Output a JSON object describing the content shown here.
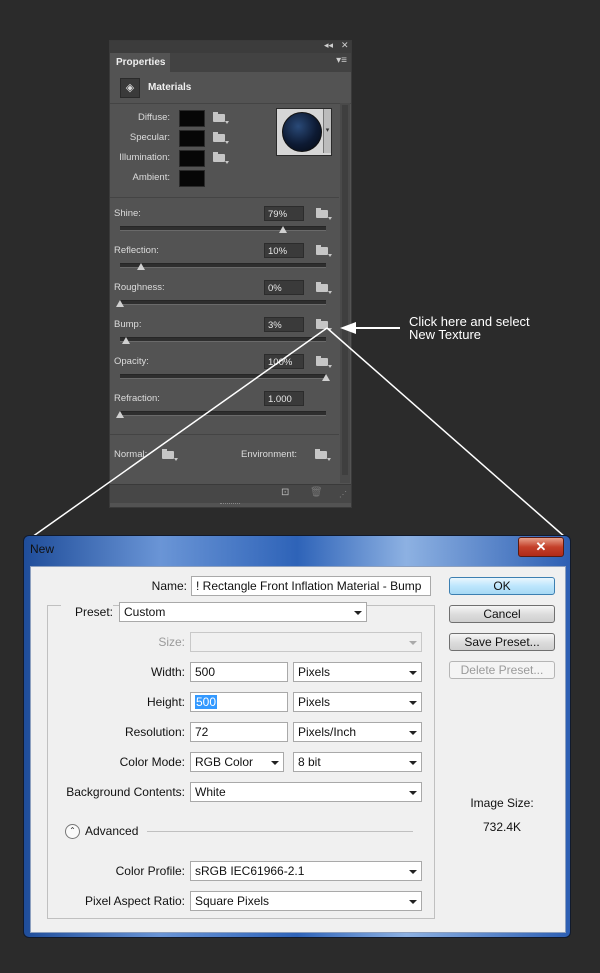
{
  "panel": {
    "collapse_glyph": "◂◂",
    "close_glyph": "✕",
    "tab_label": "Properties",
    "menu_glyph": "▾≡",
    "section_title": "Materials",
    "material_labels": {
      "diffuse": "Diffuse:",
      "specular": "Specular:",
      "illumination": "Illumination:",
      "ambient": "Ambient:"
    },
    "sliders": [
      {
        "label": "Shine:",
        "value": "79%",
        "level": 0.79
      },
      {
        "label": "Reflection:",
        "value": "10%",
        "level": 0.1
      },
      {
        "label": "Roughness:",
        "value": "0%",
        "level": 0.0
      },
      {
        "label": "Bump:",
        "value": "3%",
        "level": 0.03
      },
      {
        "label": "Opacity:",
        "value": "100%",
        "level": 1.0
      },
      {
        "label": "Refraction:",
        "value": "1.000",
        "level": 0.0
      }
    ],
    "normal_label": "Normal:",
    "environment_label": "Environment:",
    "footer_icons": [
      "new-icon",
      "trash-icon"
    ]
  },
  "callout": {
    "line1": "Click here and select",
    "line2": "New Texture"
  },
  "dialog": {
    "title": "New",
    "close_glyph": "✕",
    "name_label": "Name:",
    "name_value": "! Rectangle Front Inflation Material - Bump",
    "preset_label": "Preset:",
    "preset_value": "Custom",
    "size_label": "Size:",
    "size_value": "",
    "width_label": "Width:",
    "width_value": "500",
    "width_unit": "Pixels",
    "height_label": "Height:",
    "height_value": "500",
    "height_unit": "Pixels",
    "resolution_label": "Resolution:",
    "resolution_value": "72",
    "resolution_unit": "Pixels/Inch",
    "color_mode_label": "Color Mode:",
    "color_mode_value": "RGB Color",
    "bit_depth_value": "8 bit",
    "background_label": "Background Contents:",
    "background_value": "White",
    "advanced_label": "Advanced",
    "advanced_glyph": "⌃",
    "color_profile_label": "Color Profile:",
    "color_profile_value": "sRGB IEC61966-2.1",
    "pixel_aspect_label": "Pixel Aspect Ratio:",
    "pixel_aspect_value": "Square Pixels",
    "buttons": {
      "ok": "OK",
      "cancel": "Cancel",
      "save_preset": "Save Preset...",
      "delete_preset": "Delete Preset..."
    },
    "image_size_label": "Image Size:",
    "image_size_value": "732.4K"
  }
}
